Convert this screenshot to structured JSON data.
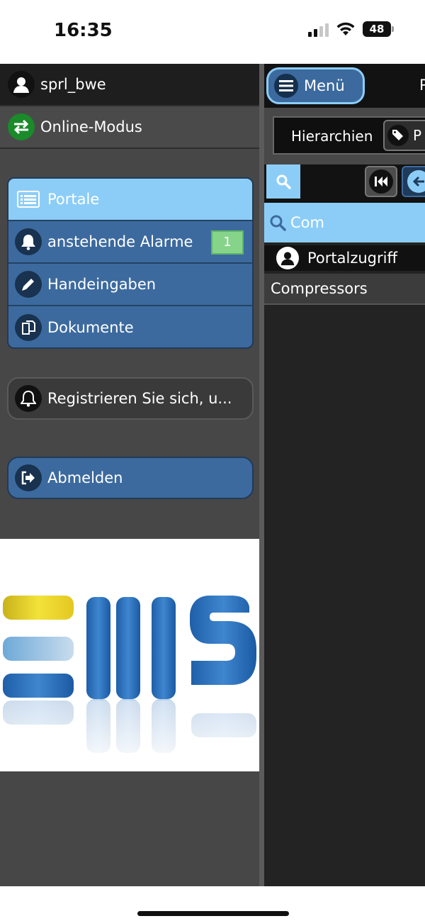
{
  "status_bar": {
    "time": "16:35",
    "battery": "48"
  },
  "left_panel": {
    "user": {
      "name": "sprl_bwe",
      "icon": "user-icon"
    },
    "mode": {
      "label": "Online-Modus",
      "icon": "sync-arrows-icon",
      "color": "#1a8a2a"
    },
    "nav": [
      {
        "label": "Portale",
        "icon": "list-icon",
        "active": true
      },
      {
        "label": "anstehende Alarme",
        "icon": "bell-icon",
        "badge": "1"
      },
      {
        "label": "Handeingaben",
        "icon": "pencil-icon"
      },
      {
        "label": "Dokumente",
        "icon": "documents-icon"
      }
    ],
    "register": {
      "label": "Registrieren Sie sich, u...",
      "icon": "bell-outline-icon"
    },
    "logout": {
      "label": "Abmelden",
      "icon": "logout-icon"
    },
    "logo": {
      "text": "EMS"
    }
  },
  "right_panel": {
    "menu_label": "Menü",
    "truncated_title": "P",
    "hierarchy_label": "Hierarchien",
    "tag_label": "P",
    "search": {
      "value": "Com"
    },
    "portal_header": "Portalzugriff",
    "results": [
      "Compressors"
    ]
  },
  "colors": {
    "accent_blue": "#3c6a9e",
    "active_light_blue": "#8ccdf7",
    "badge_green": "#86d48a",
    "panel_gray": "#474747",
    "online_green": "#1a8a2a"
  }
}
